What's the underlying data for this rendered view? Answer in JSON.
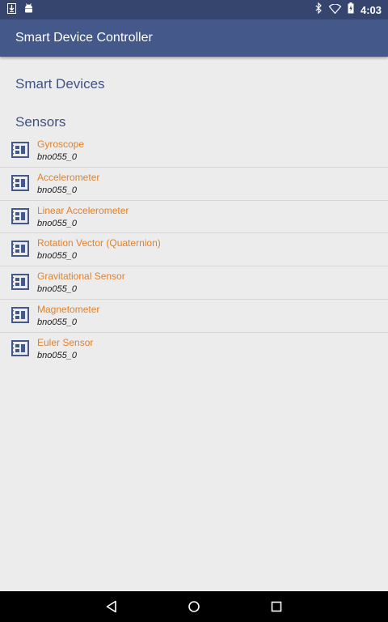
{
  "status_bar": {
    "time": "4:03",
    "left_icons": [
      "download-notification-icon",
      "android-debug-icon"
    ],
    "right_icons": [
      "bluetooth-icon",
      "wifi-icon",
      "battery-charging-icon"
    ]
  },
  "app_bar": {
    "title": "Smart Device Controller"
  },
  "sections": {
    "smart_devices": "Smart Devices",
    "sensors": "Sensors"
  },
  "sensors": [
    {
      "name": "Gyroscope",
      "id": "bno055_0"
    },
    {
      "name": "Accelerometer",
      "id": "bno055_0"
    },
    {
      "name": "Linear Accelerometer",
      "id": "bno055_0"
    },
    {
      "name": "Rotation Vector (Quaternion)",
      "id": "bno055_0"
    },
    {
      "name": "Gravitational Sensor",
      "id": "bno055_0"
    },
    {
      "name": "Magnetometer",
      "id": "bno055_0"
    },
    {
      "name": "Euler Sensor",
      "id": "bno055_0"
    }
  ],
  "sensor_icon": "chip-icon",
  "nav_bar": {
    "buttons": [
      "back-icon",
      "home-icon",
      "recents-icon"
    ]
  },
  "colors": {
    "status_bar": "#36456e",
    "app_bar": "#44598a",
    "section_header": "#3f5383",
    "sensor_name": "#e0822c",
    "icon": "#44598a"
  }
}
